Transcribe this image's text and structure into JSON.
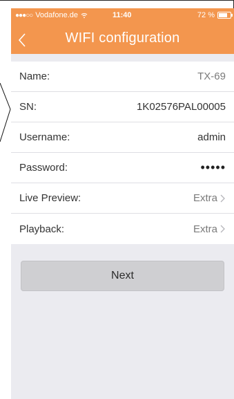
{
  "status_bar": {
    "signal": "●●●○○",
    "carrier": "Vodafone.de",
    "time": "11:40",
    "battery": "72 %"
  },
  "nav": {
    "back_icon": "chevron-left-icon",
    "title": "WIFI configuration"
  },
  "list": {
    "rows": [
      {
        "label": "Name:",
        "value": "TX-69"
      },
      {
        "label": "SN:",
        "value": "1K02576PAL00005"
      },
      {
        "label": "Username:",
        "value": "admin"
      },
      {
        "label": "Password:",
        "value": "•••••"
      },
      {
        "label": "Live Preview:",
        "value": "Extra"
      },
      {
        "label": "Playback:",
        "value": "Extra"
      }
    ]
  },
  "actions": {
    "next_label": "Next"
  },
  "colors": {
    "accent": "#f3964e",
    "background": "#ebebf0",
    "button": "#cfcfd2"
  }
}
